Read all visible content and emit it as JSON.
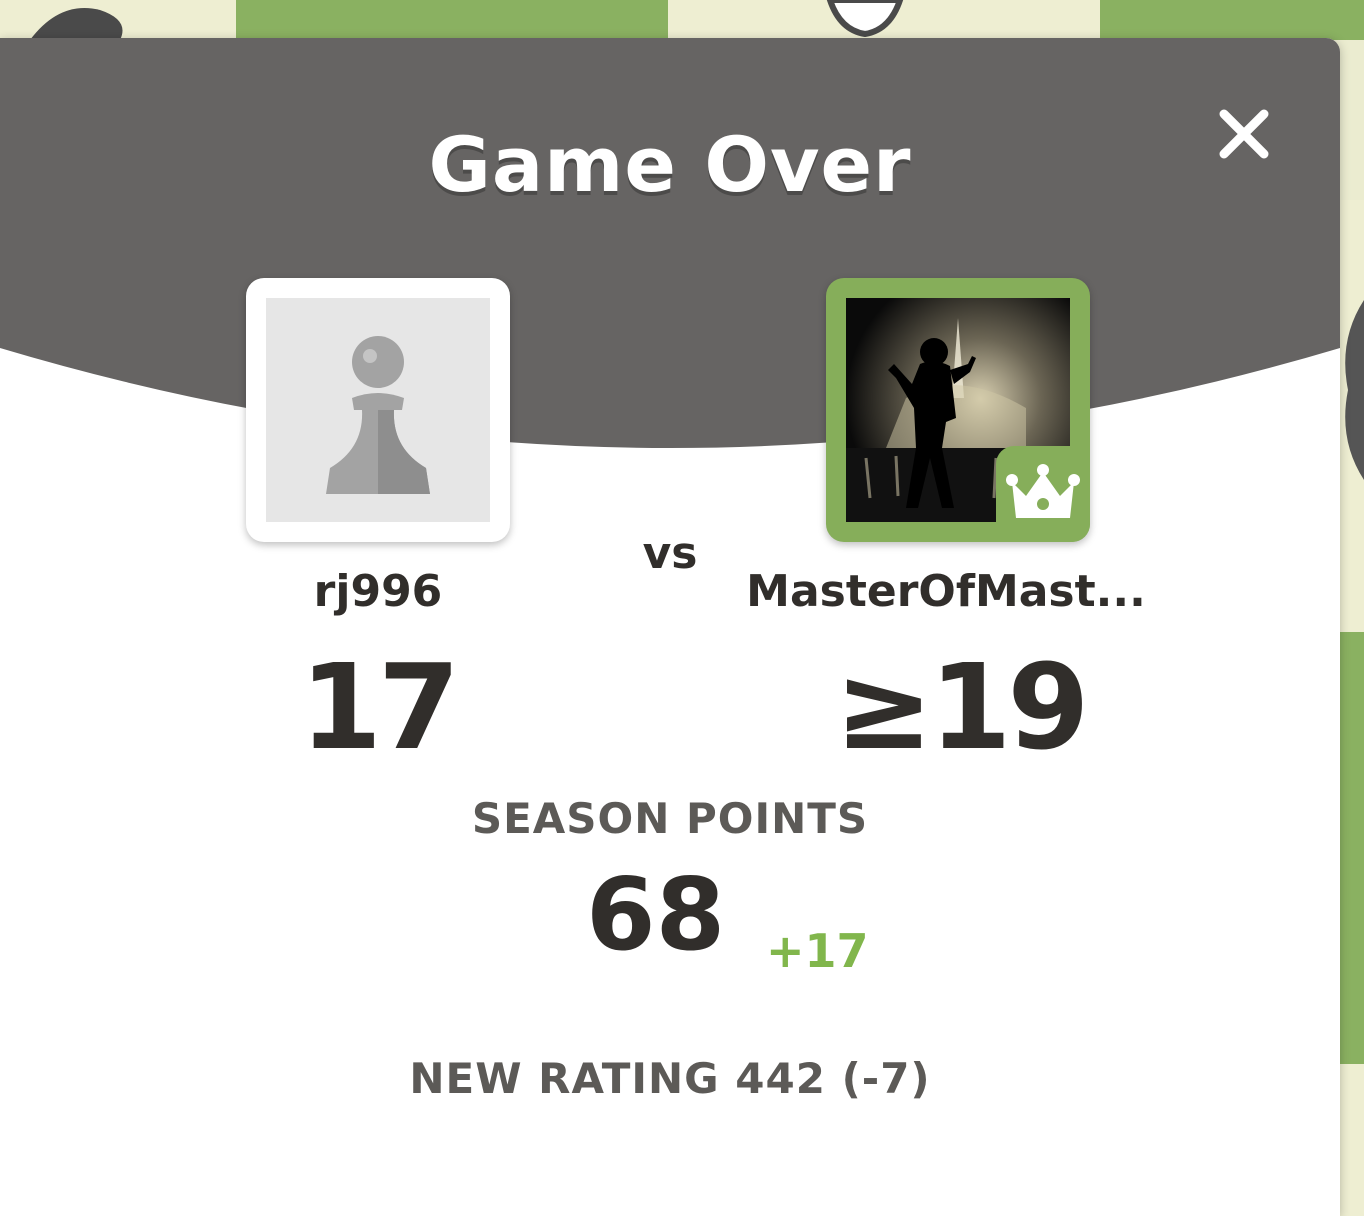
{
  "modal": {
    "title": "Game Over",
    "close_icon": "close-icon"
  },
  "players": {
    "left": {
      "name": "rj996",
      "score": "17",
      "avatar_icon": "pawn-icon"
    },
    "vs_label": "vs",
    "right": {
      "name": "MasterOfMast...",
      "score": "≥19",
      "avatar_icon": "silhouette-fountain-photo",
      "badge_icon": "crown-icon"
    }
  },
  "season": {
    "label": "SEASON POINTS",
    "value": "68",
    "delta": "+17"
  },
  "rating": {
    "text": "NEW RATING 442 (-7)"
  },
  "colors": {
    "header_gray": "#666463",
    "accent_green": "#81b64c",
    "text_dark": "#312e2b",
    "text_muted": "#5c5a57"
  }
}
